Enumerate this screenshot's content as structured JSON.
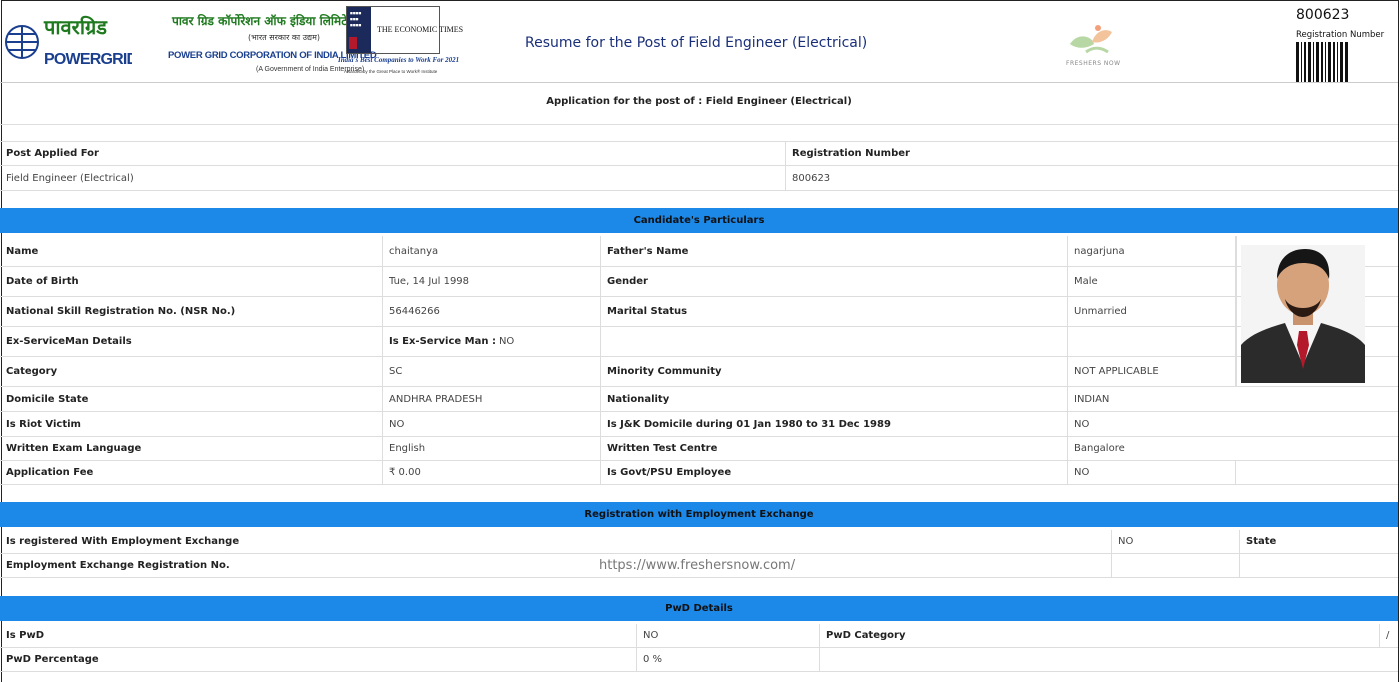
{
  "header": {
    "logo_hindi": "पावरग्रिड",
    "logo_english": "POWERGRID",
    "company_hindi": "पावर ग्रिड कॉर्पोरेशन ऑफ इंडिया लिमिटेड",
    "company_hindi_sub": "(भारत सरकार का उद्यम)",
    "company_english": "POWER GRID CORPORATION OF INDIA LIMITED",
    "company_english_sub": "(A Government of India Enterprise)",
    "et_title": "THE ECONOMIC TIMES",
    "et_tagline": "India's Best Companies to Work For 2021",
    "et_tagline_sub": "Awarded by the Great Place to Work® Institute",
    "page_title": "Resume for the Post of Field Engineer (Electrical)",
    "fresher_brand": "FRESHERS NOW",
    "registration_number": "800623",
    "registration_label": "Registration Number"
  },
  "application_post": "Application for the post of : Field Engineer (Electrical)",
  "post_table": {
    "post_label": "Post Applied For",
    "post_value": "Field Engineer (Electrical)",
    "reg_label": "Registration Number",
    "reg_value": "800623"
  },
  "candidate": {
    "heading": "Candidate's Particulars",
    "rows": [
      {
        "l1": "Name",
        "v1": "chaitanya",
        "l2": "Father's Name",
        "v2": "nagarjuna"
      },
      {
        "l1": "Date of Birth",
        "v1": "Tue, 14 Jul 1998",
        "l2": "Gender",
        "v2": "Male"
      },
      {
        "l1": "National Skill Registration No. (NSR No.)",
        "v1": "56446266",
        "l2": "Marital Status",
        "v2": "Unmarried"
      },
      {
        "l1": "Ex-ServiceMan Details",
        "v1_label": "Is Ex-Service Man : ",
        "v1": "NO",
        "l2": "",
        "v2": ""
      },
      {
        "l1": "Category",
        "v1": "SC",
        "l2": "Minority Community",
        "v2": "NOT APPLICABLE"
      },
      {
        "l1": "Domicile State",
        "v1": "ANDHRA PRADESH",
        "l2": "Nationality",
        "v2": "INDIAN"
      },
      {
        "l1": "Is Riot Victim",
        "v1": "NO",
        "l2": "Is J&K Domicile during 01 Jan 1980 to 31 Dec 1989",
        "v2": "NO"
      },
      {
        "l1": "Written Exam Language",
        "v1": "English",
        "l2": "Written Test Centre",
        "v2": "Bangalore"
      },
      {
        "l1": "Application Fee",
        "v1": "₹ 0.00",
        "l2": "Is Govt/PSU Employee",
        "v2": "NO"
      }
    ]
  },
  "employment": {
    "heading": "Registration with Employment Exchange",
    "registered_label": "Is registered With Employment Exchange",
    "registered_value": "NO",
    "state_label": "State",
    "reg_no_label": "Employment Exchange Registration No.",
    "watermark": "https://www.freshersnow.com/"
  },
  "pwd": {
    "heading": "PwD Details",
    "is_pwd_label": "Is PwD",
    "is_pwd_value": "NO",
    "category_label": "PwD Category",
    "category_value": "/",
    "percentage_label": "PwD Percentage",
    "percentage_value": "0 %"
  },
  "colors": {
    "banner": "#1c88e8",
    "title": "#1a2f7a"
  }
}
